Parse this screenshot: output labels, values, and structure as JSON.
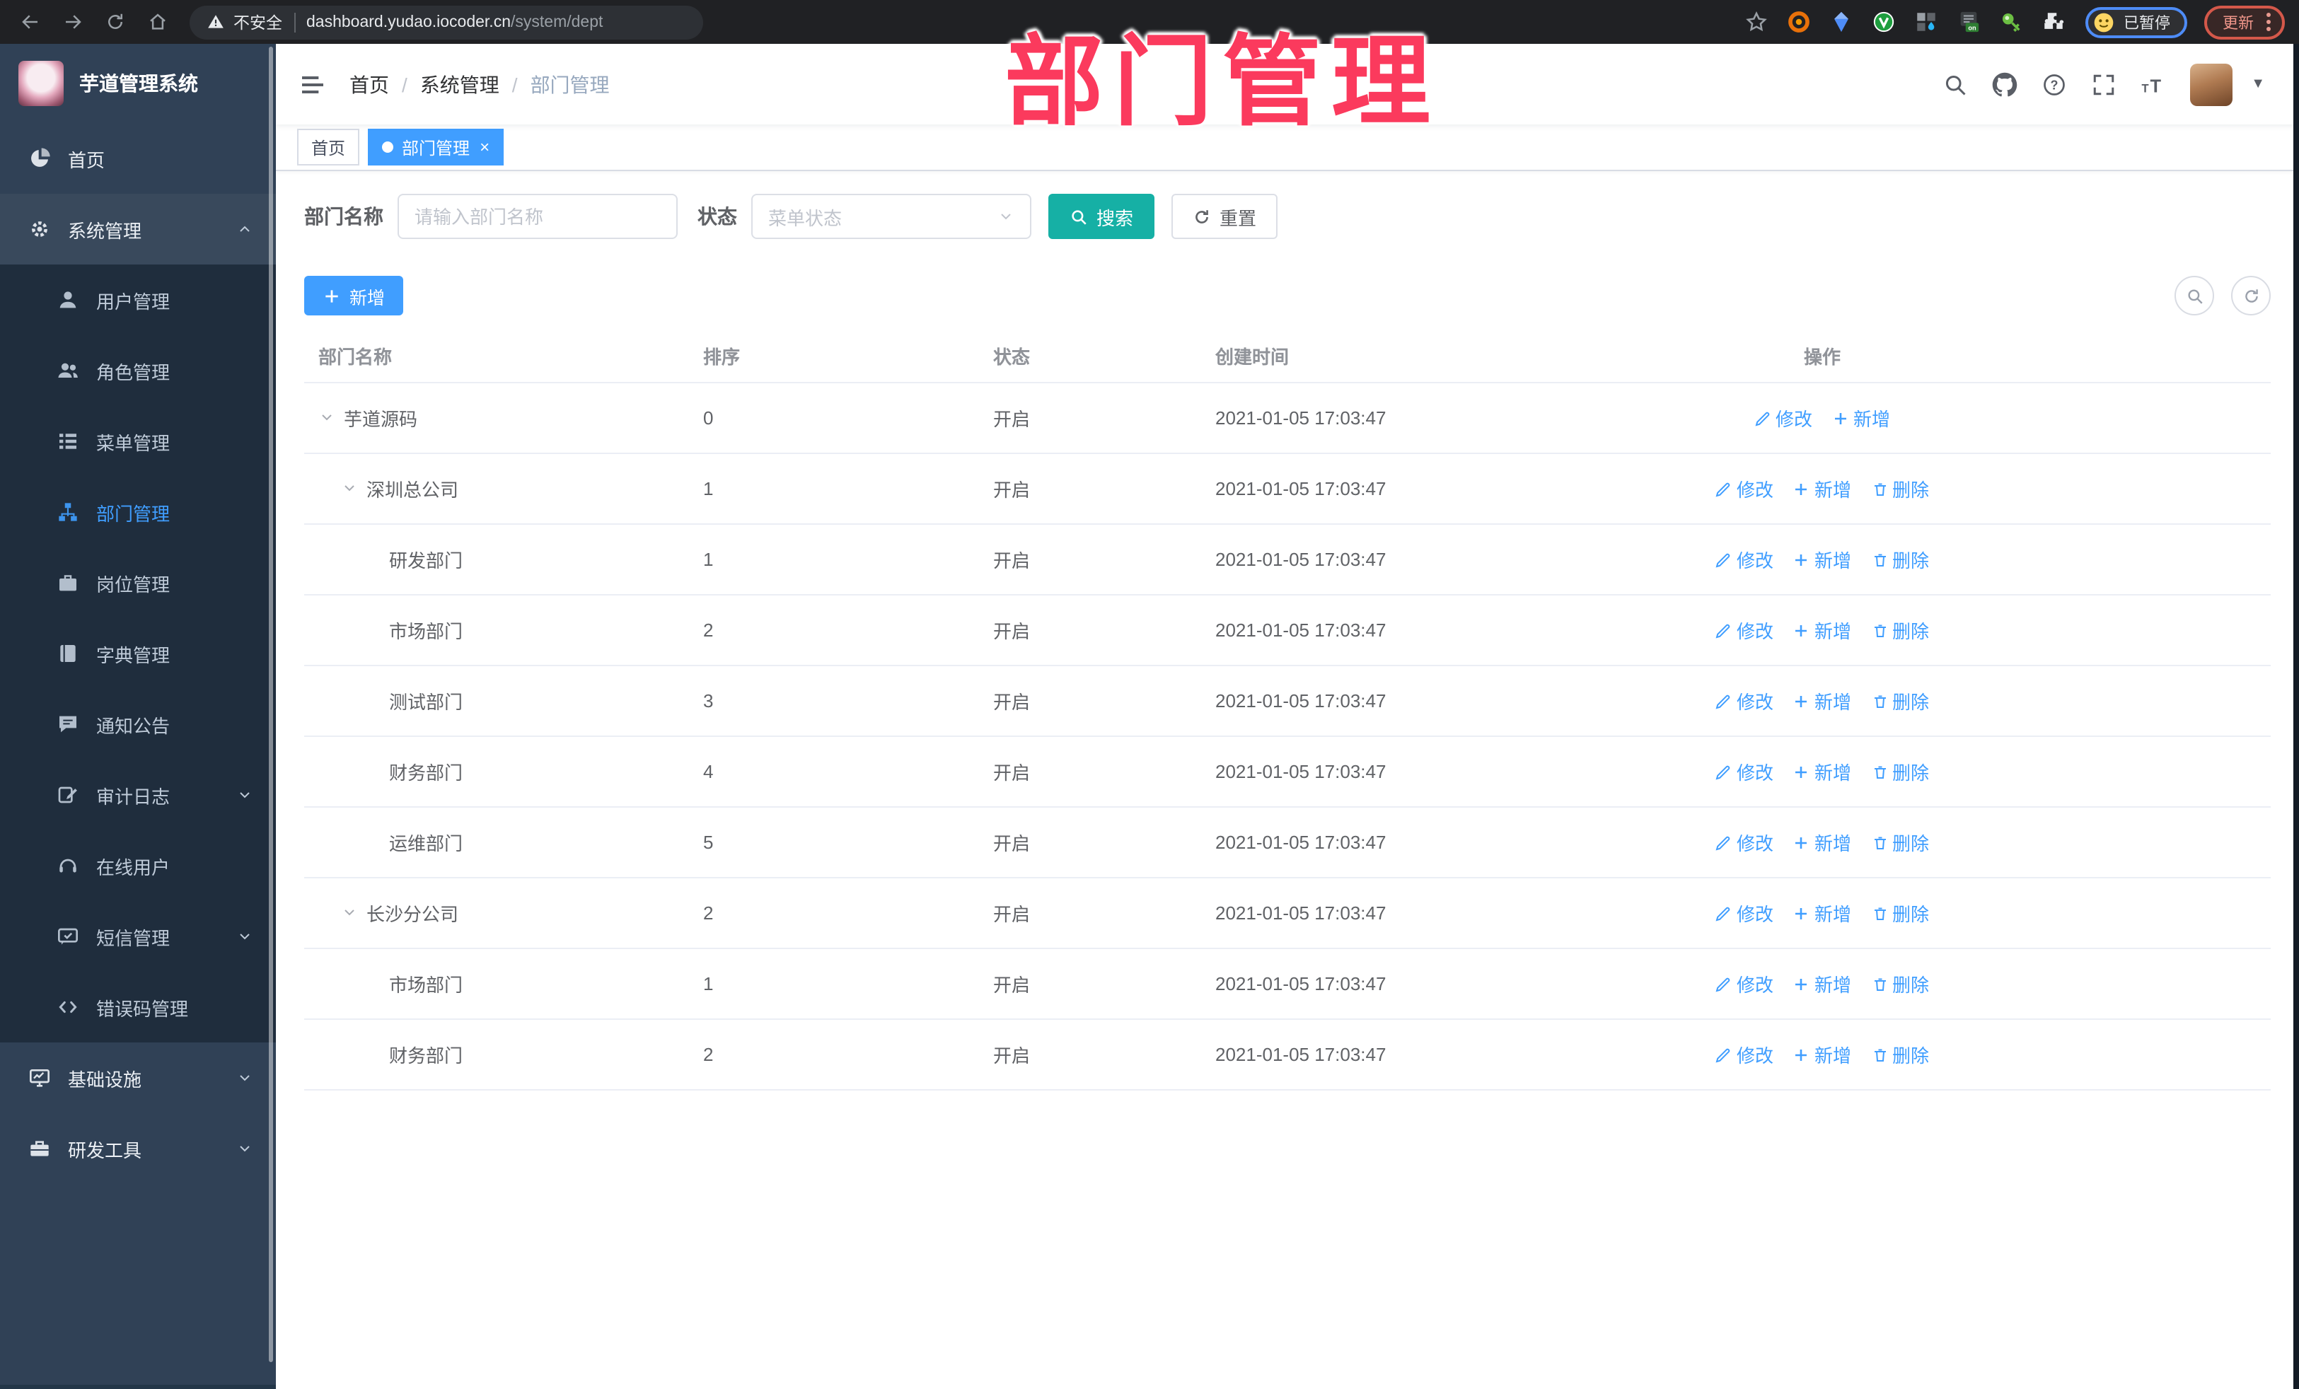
{
  "colors": {
    "accent": "#409EFF",
    "search_teal": "#16b0a5",
    "overlay_pink": "#fb3a5d",
    "sidebar_bg": "#304156",
    "submenu_bg": "#1f2d3d",
    "link_blue": "#409EFF"
  },
  "browser": {
    "security_label": "不安全",
    "url_host": "dashboard.yudao.iocoder.cn",
    "url_path": "/system/dept",
    "profile_label": "已暂停",
    "update_label": "更新"
  },
  "overlay": {
    "title": "部门管理"
  },
  "sidebar": {
    "title": "芋道管理系统",
    "items": [
      {
        "key": "home",
        "label": "首页",
        "icon": "dashboard-icon",
        "type": "top"
      },
      {
        "key": "system",
        "label": "系统管理",
        "icon": "gear-icon",
        "type": "top",
        "arrow": "up",
        "hover": true
      },
      {
        "key": "user",
        "label": "用户管理",
        "icon": "user-icon",
        "type": "sub"
      },
      {
        "key": "role",
        "label": "角色管理",
        "icon": "users-icon",
        "type": "sub"
      },
      {
        "key": "menu",
        "label": "菜单管理",
        "icon": "menu-tree-icon",
        "type": "sub"
      },
      {
        "key": "dept",
        "label": "部门管理",
        "icon": "org-tree-icon",
        "type": "sub",
        "active": true
      },
      {
        "key": "post",
        "label": "岗位管理",
        "icon": "badge-icon",
        "type": "sub"
      },
      {
        "key": "dict",
        "label": "字典管理",
        "icon": "book-icon",
        "type": "sub"
      },
      {
        "key": "notice",
        "label": "通知公告",
        "icon": "announcement-icon",
        "type": "sub"
      },
      {
        "key": "audit",
        "label": "审计日志",
        "icon": "log-icon",
        "type": "sub",
        "arrow": "down"
      },
      {
        "key": "online",
        "label": "在线用户",
        "icon": "online-icon",
        "type": "sub"
      },
      {
        "key": "sms",
        "label": "短信管理",
        "icon": "sms-icon",
        "type": "sub",
        "arrow": "down"
      },
      {
        "key": "errcode",
        "label": "错误码管理",
        "icon": "code-icon",
        "type": "sub"
      },
      {
        "key": "infra",
        "label": "基础设施",
        "icon": "monitor-icon",
        "type": "top",
        "arrow": "down"
      },
      {
        "key": "devtool",
        "label": "研发工具",
        "icon": "toolbox-icon",
        "type": "top",
        "arrow": "down"
      }
    ]
  },
  "navbar": {
    "breadcrumb": [
      {
        "label": "首页"
      },
      {
        "label": "系统管理"
      },
      {
        "label": "部门管理",
        "current": true
      }
    ]
  },
  "tags": [
    {
      "label": "首页"
    },
    {
      "label": "部门管理",
      "active": true,
      "closable": true
    }
  ],
  "filters": {
    "name_label": "部门名称",
    "name_placeholder": "请输入部门名称",
    "status_label": "状态",
    "status_placeholder": "菜单状态",
    "search_label": "搜索",
    "reset_label": "重置"
  },
  "toolbar": {
    "add_label": "新增"
  },
  "table": {
    "headers": [
      "部门名称",
      "排序",
      "状态",
      "创建时间",
      "操作"
    ],
    "rows": [
      {
        "name": "芋道源码",
        "level": 0,
        "expanded": true,
        "sort": "0",
        "status": "开启",
        "time": "2021-01-05 17:03:47",
        "actions": [
          {
            "label": "修改",
            "icon": "edit-icon"
          },
          {
            "label": "新增",
            "icon": "plus-icon"
          }
        ]
      },
      {
        "name": "深圳总公司",
        "level": 1,
        "expanded": true,
        "sort": "1",
        "status": "开启",
        "time": "2021-01-05 17:03:47",
        "actions": [
          {
            "label": "修改",
            "icon": "edit-icon"
          },
          {
            "label": "新增",
            "icon": "plus-icon"
          },
          {
            "label": "删除",
            "icon": "delete-icon"
          }
        ]
      },
      {
        "name": "研发部门",
        "level": 2,
        "sort": "1",
        "status": "开启",
        "time": "2021-01-05 17:03:47",
        "actions": [
          {
            "label": "修改",
            "icon": "edit-icon"
          },
          {
            "label": "新增",
            "icon": "plus-icon"
          },
          {
            "label": "删除",
            "icon": "delete-icon"
          }
        ]
      },
      {
        "name": "市场部门",
        "level": 2,
        "sort": "2",
        "status": "开启",
        "time": "2021-01-05 17:03:47",
        "actions": [
          {
            "label": "修改",
            "icon": "edit-icon"
          },
          {
            "label": "新增",
            "icon": "plus-icon"
          },
          {
            "label": "删除",
            "icon": "delete-icon"
          }
        ]
      },
      {
        "name": "测试部门",
        "level": 2,
        "sort": "3",
        "status": "开启",
        "time": "2021-01-05 17:03:47",
        "actions": [
          {
            "label": "修改",
            "icon": "edit-icon"
          },
          {
            "label": "新增",
            "icon": "plus-icon"
          },
          {
            "label": "删除",
            "icon": "delete-icon"
          }
        ]
      },
      {
        "name": "财务部门",
        "level": 2,
        "sort": "4",
        "status": "开启",
        "time": "2021-01-05 17:03:47",
        "actions": [
          {
            "label": "修改",
            "icon": "edit-icon"
          },
          {
            "label": "新增",
            "icon": "plus-icon"
          },
          {
            "label": "删除",
            "icon": "delete-icon"
          }
        ]
      },
      {
        "name": "运维部门",
        "level": 2,
        "sort": "5",
        "status": "开启",
        "time": "2021-01-05 17:03:47",
        "actions": [
          {
            "label": "修改",
            "icon": "edit-icon"
          },
          {
            "label": "新增",
            "icon": "plus-icon"
          },
          {
            "label": "删除",
            "icon": "delete-icon"
          }
        ]
      },
      {
        "name": "长沙分公司",
        "level": 1,
        "expanded": true,
        "sort": "2",
        "status": "开启",
        "time": "2021-01-05 17:03:47",
        "actions": [
          {
            "label": "修改",
            "icon": "edit-icon"
          },
          {
            "label": "新增",
            "icon": "plus-icon"
          },
          {
            "label": "删除",
            "icon": "delete-icon"
          }
        ]
      },
      {
        "name": "市场部门",
        "level": 2,
        "sort": "1",
        "status": "开启",
        "time": "2021-01-05 17:03:47",
        "actions": [
          {
            "label": "修改",
            "icon": "edit-icon"
          },
          {
            "label": "新增",
            "icon": "plus-icon"
          },
          {
            "label": "删除",
            "icon": "delete-icon"
          }
        ]
      },
      {
        "name": "财务部门",
        "level": 2,
        "sort": "2",
        "status": "开启",
        "time": "2021-01-05 17:03:47",
        "actions": [
          {
            "label": "修改",
            "icon": "edit-icon"
          },
          {
            "label": "新增",
            "icon": "plus-icon"
          },
          {
            "label": "删除",
            "icon": "delete-icon"
          }
        ]
      }
    ]
  }
}
